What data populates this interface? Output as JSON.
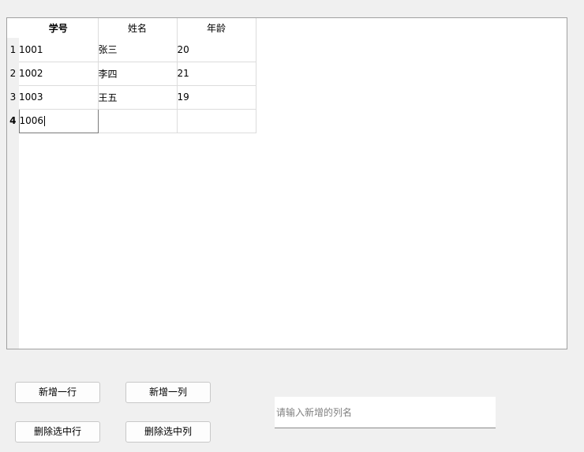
{
  "table": {
    "columns": [
      "学号",
      "姓名",
      "年龄"
    ],
    "rows": [
      {
        "index": "1",
        "cells": [
          "1001",
          "张三",
          "20"
        ]
      },
      {
        "index": "2",
        "cells": [
          "1002",
          "李四",
          "21"
        ]
      },
      {
        "index": "3",
        "cells": [
          "1003",
          "王五",
          "19"
        ]
      },
      {
        "index": "4",
        "cells": [
          "1006",
          "",
          ""
        ]
      }
    ]
  },
  "buttons": {
    "add_row": "新增一行",
    "add_column": "新增一列",
    "delete_row": "删除选中行",
    "delete_column": "删除选中列"
  },
  "column_name_input": {
    "value": "",
    "placeholder": "请输入新增的列名"
  }
}
